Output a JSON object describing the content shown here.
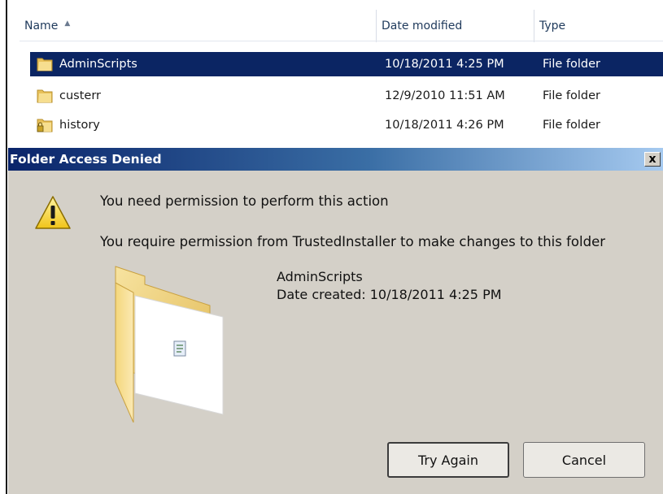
{
  "explorer": {
    "columns": {
      "name": "Name",
      "date_modified": "Date modified",
      "type": "Type"
    },
    "rows": [
      {
        "name": "AdminScripts",
        "date": "10/18/2011 4:25 PM",
        "type": "File folder",
        "selected": true,
        "icon": "folder-icon"
      },
      {
        "name": "custerr",
        "date": "12/9/2010 11:51 AM",
        "type": "File folder",
        "selected": false,
        "icon": "folder-icon"
      },
      {
        "name": "history",
        "date": "10/18/2011 4:26 PM",
        "type": "File folder",
        "selected": false,
        "icon": "locked-folder-icon"
      }
    ]
  },
  "dialog": {
    "title": "Folder Access Denied",
    "close_label": "x",
    "message1": "You need permission to perform this action",
    "message2": "You require permission from TrustedInstaller to make changes to this folder",
    "folder_name": "AdminScripts",
    "date_created": "Date created: 10/18/2011 4:25 PM",
    "try_again_label": "Try Again",
    "cancel_label": "Cancel",
    "warning_icon": "warning-icon"
  },
  "colors": {
    "selection": "#0b2563",
    "title_bar_start": "#0a246a",
    "dialog_bg": "#d4d0c8",
    "folder": "#f2d27a"
  }
}
